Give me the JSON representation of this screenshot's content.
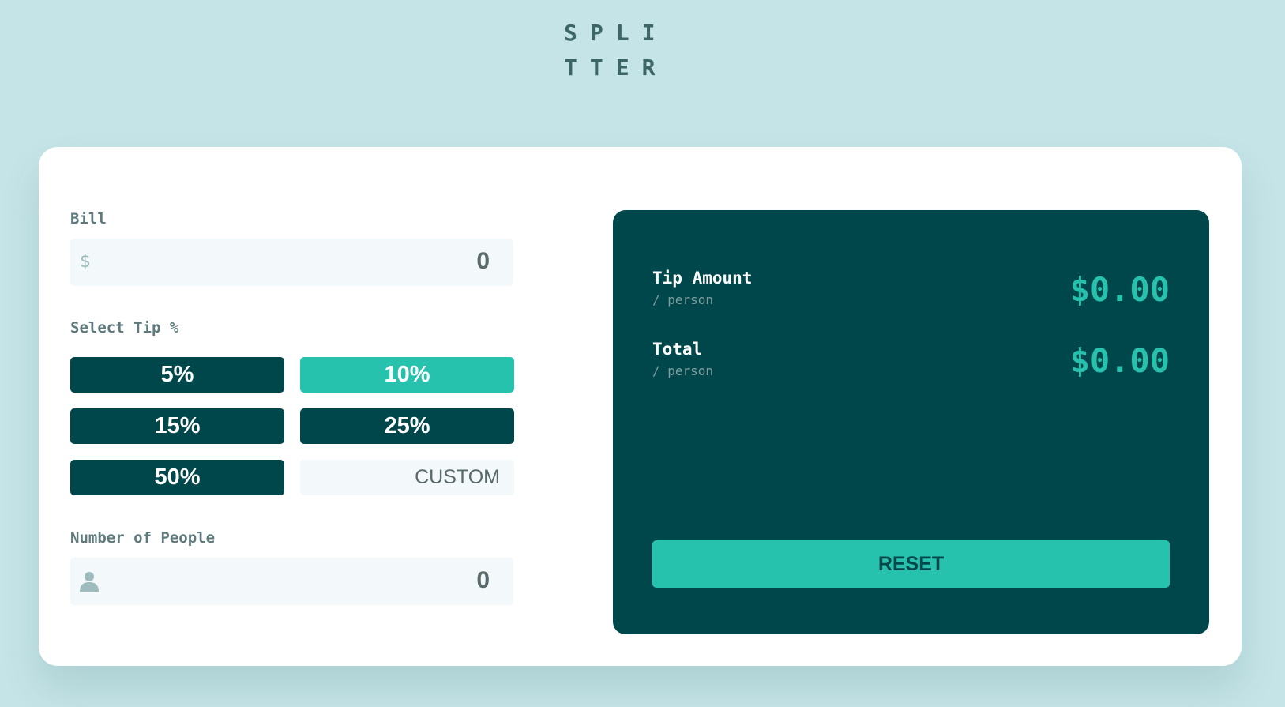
{
  "header": {
    "logo_line1": "SPLI",
    "logo_line2": "TTER"
  },
  "form": {
    "bill_label": "Bill",
    "bill_prefix": "$",
    "bill_value": "0",
    "tip_label": "Select Tip %",
    "tip_options": [
      "5%",
      "10%",
      "15%",
      "25%",
      "50%"
    ],
    "selected_tip": "10%",
    "custom_placeholder": "CUSTOM",
    "people_label": "Number of People",
    "people_value": "0"
  },
  "result": {
    "tip_label": "Tip Amount",
    "tip_sub": "/ person",
    "tip_value": "$0.00",
    "total_label": "Total",
    "total_sub": "/ person",
    "total_value": "$0.00",
    "reset_label": "RESET"
  },
  "colors": {
    "background": "#c5e4e7",
    "dark_teal": "#00474b",
    "accent": "#26c2ae",
    "input_bg": "#f3f8fb"
  },
  "icons": {
    "bill_prefix": "dollar-icon",
    "people_prefix": "person-icon"
  }
}
